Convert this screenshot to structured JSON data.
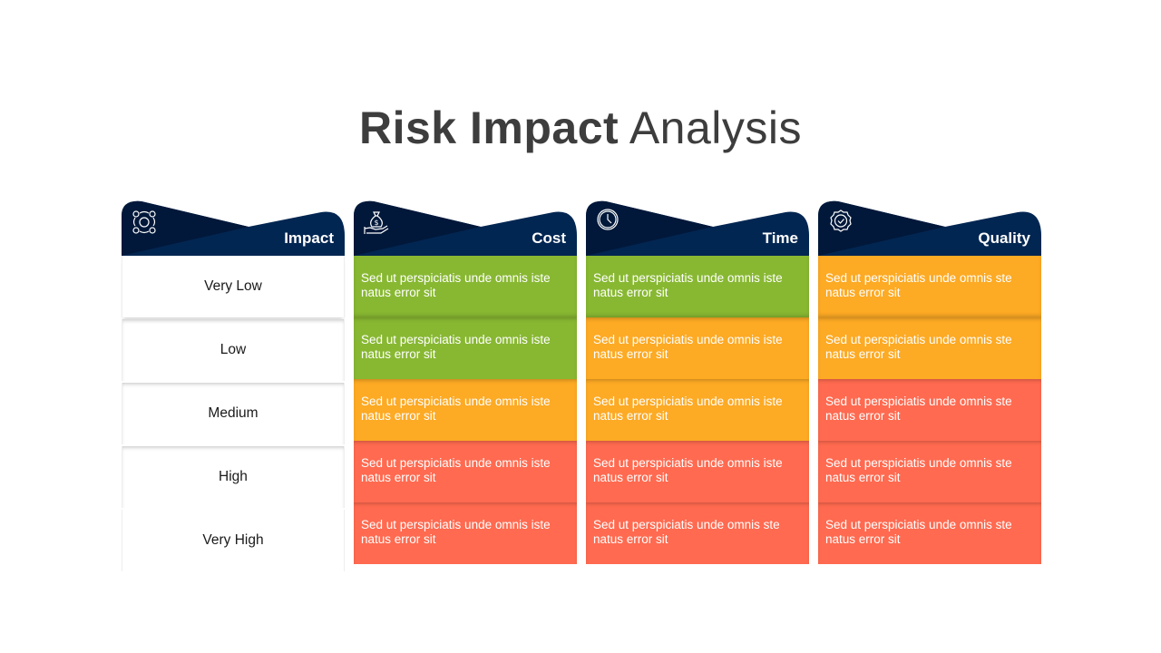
{
  "title": {
    "bold": "Risk Impact",
    "light": "Analysis"
  },
  "colors": {
    "header": "#022652",
    "header_dark": "#01183a",
    "green": "#88b832",
    "amber": "#fdaa24",
    "red": "#ff6a50",
    "text_dark": "#3d3d3d"
  },
  "columns": [
    {
      "label": "Impact",
      "icon": "risk-cycle-icon"
    },
    {
      "label": "Cost",
      "icon": "money-bag-hand-icon"
    },
    {
      "label": "Time",
      "icon": "clock-icon"
    },
    {
      "label": "Quality",
      "icon": "quality-badge-icon"
    }
  ],
  "levels": [
    "Very Low",
    "Low",
    "Medium",
    "High",
    "Very High"
  ],
  "grid": {
    "cost": [
      {
        "text": "Sed ut perspiciatis unde omnis iste natus error sit",
        "color": "green"
      },
      {
        "text": "Sed ut perspiciatis unde omnis iste natus error sit",
        "color": "green"
      },
      {
        "text": "Sed ut perspiciatis unde omnis iste natus error sit",
        "color": "amber"
      },
      {
        "text": "Sed ut perspiciatis unde omnis iste natus error sit",
        "color": "red"
      },
      {
        "text": "Sed ut perspiciatis unde omnis iste natus error sit",
        "color": "red"
      }
    ],
    "time": [
      {
        "text": "Sed ut perspiciatis unde omnis iste natus error sit",
        "color": "green"
      },
      {
        "text": "Sed ut perspiciatis unde omnis iste natus error sit",
        "color": "amber"
      },
      {
        "text": "Sed ut perspiciatis unde omnis iste natus error sit",
        "color": "amber"
      },
      {
        "text": "Sed ut perspiciatis unde omnis iste natus error sit",
        "color": "red"
      },
      {
        "text": "Sed ut perspiciatis unde omnis ste natus error sit",
        "color": "red"
      }
    ],
    "quality": [
      {
        "text": "Sed ut perspiciatis unde omnis ste natus error sit",
        "color": "amber"
      },
      {
        "text": "Sed ut perspiciatis unde omnis ste natus error sit",
        "color": "amber"
      },
      {
        "text": "Sed ut perspiciatis unde omnis ste natus error sit",
        "color": "red"
      },
      {
        "text": "Sed ut perspiciatis unde omnis ste natus error sit",
        "color": "red"
      },
      {
        "text": "Sed ut perspiciatis unde omnis ste natus error sit",
        "color": "red"
      }
    ]
  }
}
